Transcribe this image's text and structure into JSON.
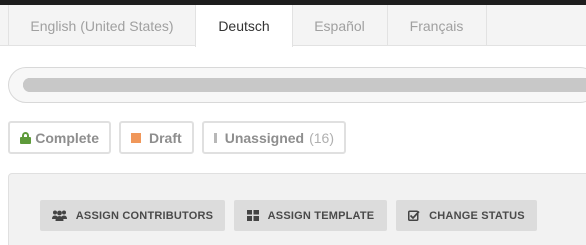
{
  "tabs": [
    {
      "label": "English (United States)",
      "active": false
    },
    {
      "label": "Deutsch",
      "active": true
    },
    {
      "label": "Español",
      "active": false
    },
    {
      "label": "Français",
      "active": false
    }
  ],
  "progress": {
    "fraction": 1.0
  },
  "filters": {
    "complete": {
      "label": "Complete",
      "icon": "unlock-icon",
      "color": "#5e9a3a"
    },
    "draft": {
      "label": "Draft",
      "icon": "square-icon",
      "color": "#f0975a"
    },
    "unassigned": {
      "label": "Unassigned",
      "count": "(16)",
      "icon": "square-icon",
      "color": "#b8b8b8"
    }
  },
  "actions": {
    "assign_contributors": {
      "label": "ASSIGN CONTRIBUTORS",
      "icon": "users-icon"
    },
    "assign_template": {
      "label": "ASSIGN TEMPLATE",
      "icon": "grid-icon"
    },
    "change_status": {
      "label": "CHANGE STATUS",
      "icon": "checkbox-icon"
    }
  }
}
